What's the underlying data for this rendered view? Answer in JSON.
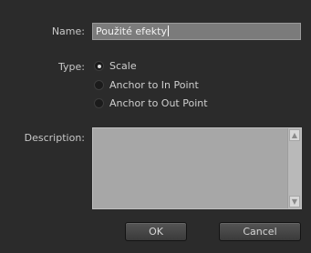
{
  "form": {
    "name_label": "Name:",
    "name_value": "Použité efekty",
    "type_label": "Type:",
    "type_options": [
      {
        "label": "Scale",
        "selected": true
      },
      {
        "label": "Anchor to In Point",
        "selected": false
      },
      {
        "label": "Anchor to Out Point",
        "selected": false
      }
    ],
    "description_label": "Description:",
    "description_value": ""
  },
  "buttons": {
    "ok_label": "OK",
    "cancel_label": "Cancel"
  },
  "icons": {
    "scroll_up": "chevron-up-icon",
    "scroll_down": "chevron-down-icon"
  },
  "colors": {
    "background": "#2b2b2b",
    "field_background": "#7b7b7b",
    "textarea_background": "#a7a7a7",
    "text": "#d0d0d0"
  }
}
